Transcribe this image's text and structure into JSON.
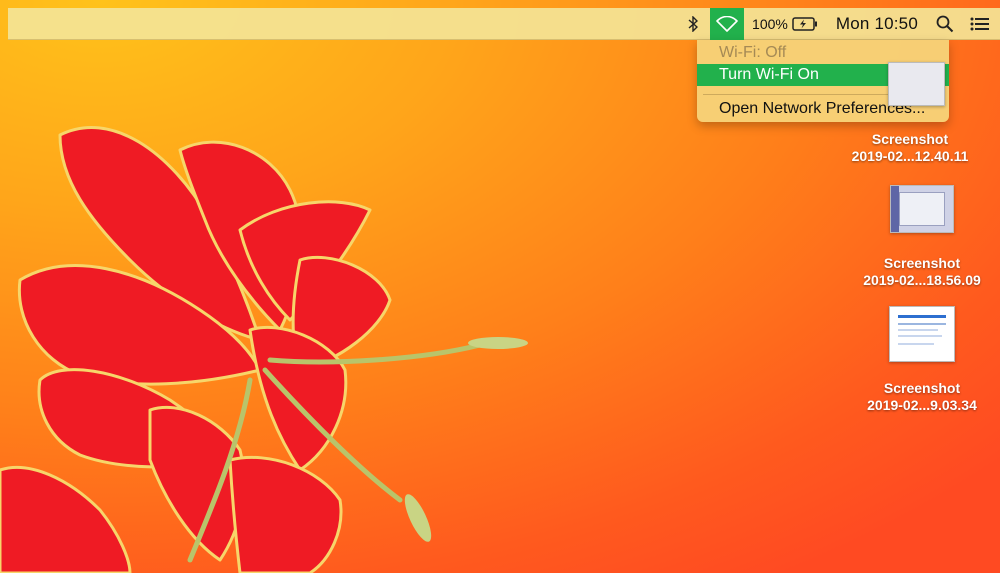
{
  "menubar": {
    "battery_pct": "100%",
    "clock": "Mon 10:50"
  },
  "wifi_menu": {
    "status": "Wi-Fi: Off",
    "turn_on": "Turn Wi-Fi On",
    "open_prefs": "Open Network Preferences..."
  },
  "desktop_icons": [
    {
      "name": "Screenshot",
      "subtitle": "2019-02...12.40.11"
    },
    {
      "name": "Screenshot",
      "subtitle": "2019-02...18.56.09"
    },
    {
      "name": "Screenshot",
      "subtitle": "2019-02...9.03.34"
    }
  ],
  "colors": {
    "highlight": "#22b14c",
    "flower": "#ef1b24"
  }
}
